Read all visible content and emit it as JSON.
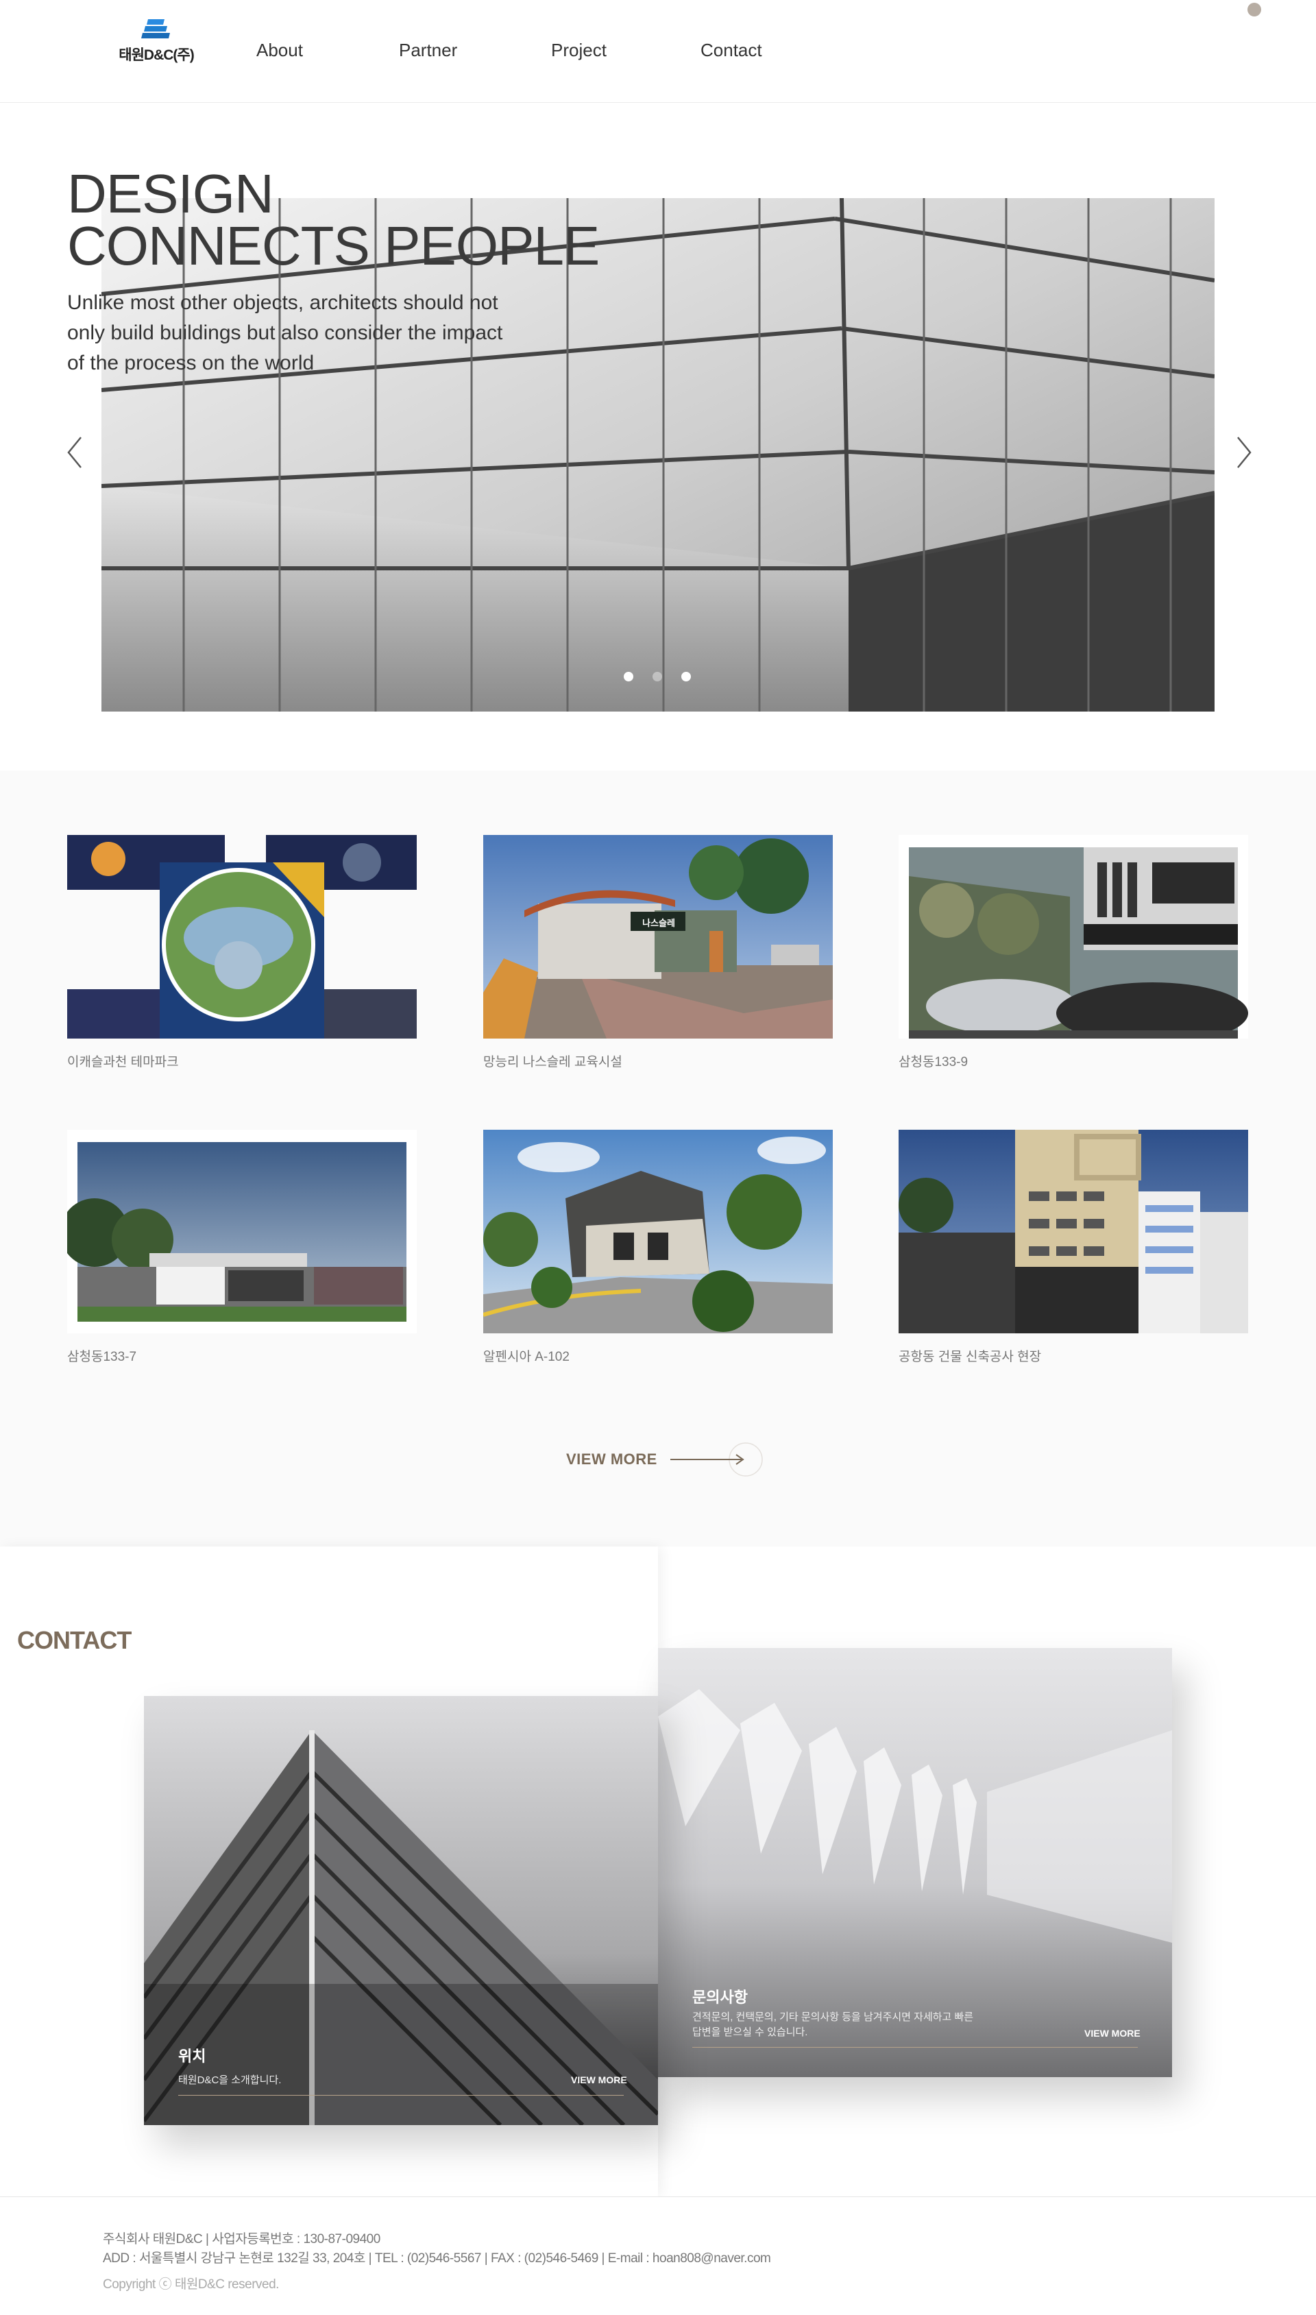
{
  "header": {
    "logo_text": "태원D&C(주)",
    "nav": [
      "About",
      "Partner",
      "Project",
      "Contact"
    ]
  },
  "hero": {
    "title_line1": "DESIGN",
    "title_line2": "CONNECTS PEOPLE",
    "description": "Unlike most other objects, architects should not only build buildings but also consider the impact of the process on the world",
    "slide_count": 3,
    "active_slide": 3
  },
  "projects": {
    "items": [
      {
        "caption": "이캐슬과천 테마파크"
      },
      {
        "caption": "망능리 나스슬레 교육시설",
        "sign": "나스슬레"
      },
      {
        "caption": "삼청동133-9"
      },
      {
        "caption": "삼청동133-7"
      },
      {
        "caption": "알펜시아 A-102"
      },
      {
        "caption": "공항동 건물 신축공사 현장"
      }
    ],
    "view_more": "VIEW MORE"
  },
  "contact": {
    "title": "CONTACT",
    "location_card": {
      "title": "위치",
      "desc": "태원D&C을 소개합니다.",
      "more": "VIEW MORE"
    },
    "inquiry_card": {
      "title": "문의사항",
      "desc_line1": "견적문의, 컨택문의, 기타 문의사항 등을 남겨주시면 자세하고 빠른",
      "desc_line2": "답변을 받으실 수 있습니다.",
      "more": "VIEW MORE"
    }
  },
  "footer": {
    "line1": "주식회사 태원D&C  |  사업자등록번호 : 130-87-09400",
    "line2": "ADD : 서울특별시 강남구 논현로 132길 33, 204호 | TEL : (02)546-5567 | FAX : (02)546-5469 | E-mail : hoan808@naver.com",
    "copyright": "Copyright ⓒ 태원D&C reserved."
  },
  "colors": {
    "accent": "#7c6c5b",
    "logo_blue": "#1f7fd1",
    "dot": "#b7ada3"
  }
}
